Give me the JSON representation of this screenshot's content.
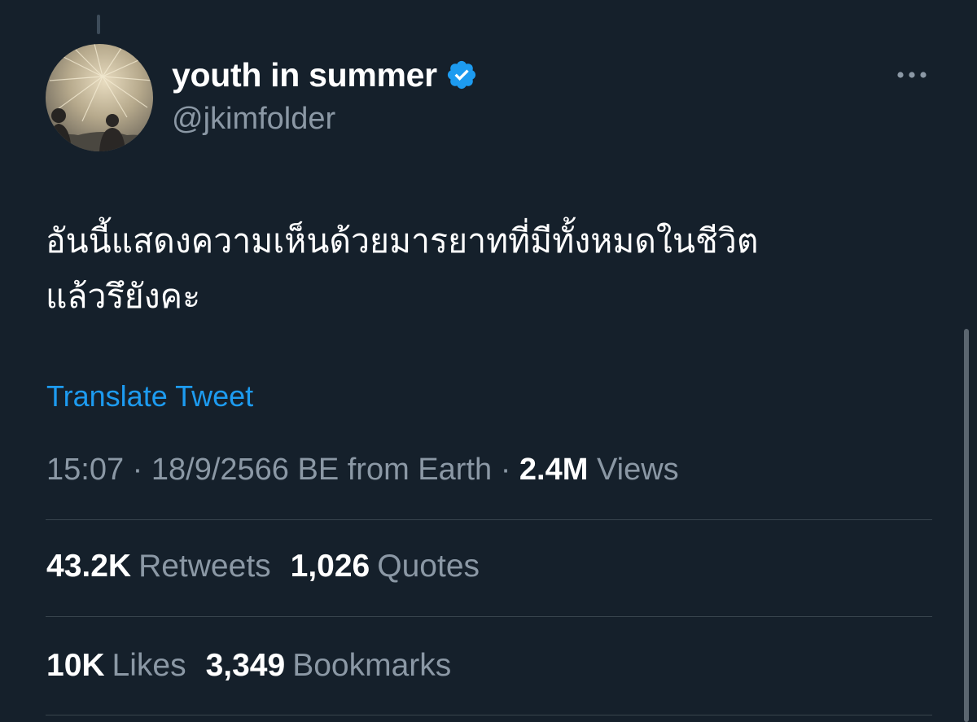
{
  "user": {
    "display_name": "youth in summer",
    "handle": "@jkimfolder",
    "verified": true
  },
  "tweet": {
    "text_line1": "อันนี้แสดงความเห็นด้วยมารยาทที่มีทั้งหมดในชีวิต",
    "text_line2": "แล้วรึยังคะ",
    "translate_label": "Translate Tweet"
  },
  "meta": {
    "time": "15:07",
    "date": "18/9/2566 BE",
    "source": "from Earth",
    "views_count": "2.4M",
    "views_label": "Views"
  },
  "stats_row1": [
    {
      "count": "43.2K",
      "label": "Retweets"
    },
    {
      "count": "1,026",
      "label": "Quotes"
    }
  ],
  "stats_row2": [
    {
      "count": "10K",
      "label": "Likes"
    },
    {
      "count": "3,349",
      "label": "Bookmarks"
    }
  ],
  "icons": {
    "verified": "verified-badge-icon",
    "more": "more-horizontal-icon"
  },
  "colors": {
    "background": "#15202b",
    "link": "#1d9bf0",
    "secondary_text": "#8b98a5",
    "divider": "#38444d"
  }
}
